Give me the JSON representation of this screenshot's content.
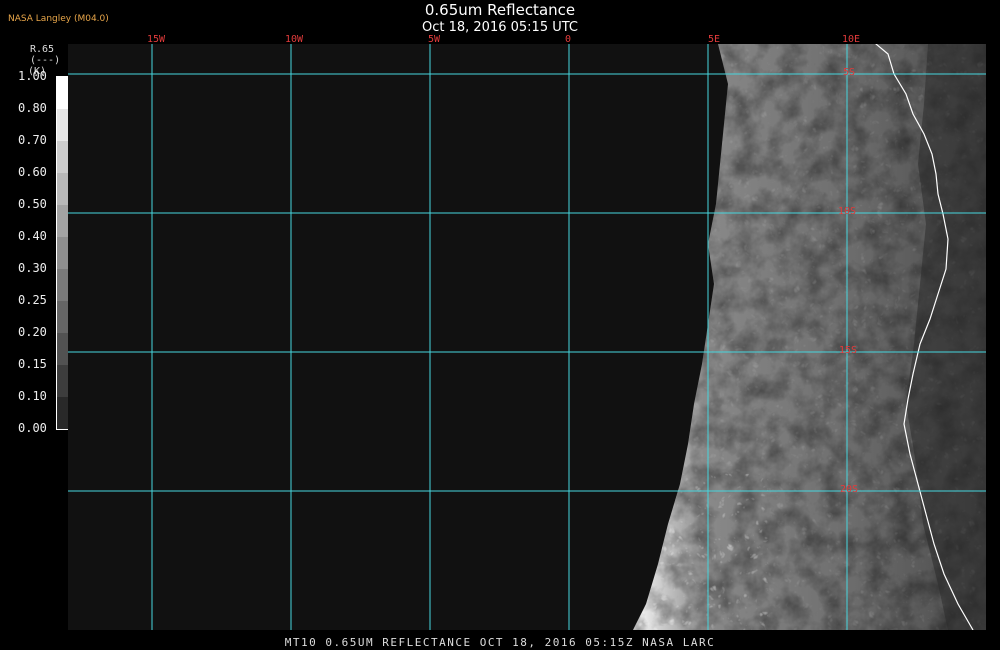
{
  "header": {
    "title": "0.65um Reflectance",
    "subtitle": "Oct 18, 2016 05:15 UTC",
    "producer": "NASA Langley (M04.0)"
  },
  "legend": {
    "title_lines": [
      "R.65",
      "(---)",
      "(K)"
    ],
    "ticks": [
      "1.00",
      "0.80",
      "0.70",
      "0.60",
      "0.50",
      "0.40",
      "0.30",
      "0.25",
      "0.20",
      "0.15",
      "0.10",
      "0.00"
    ]
  },
  "grid": {
    "longitude_labels": [
      "15W",
      "10W",
      "5W",
      "0",
      "5E",
      "10E"
    ],
    "latitude_labels": [
      "5S",
      "10S",
      "15S",
      "20S"
    ],
    "line_color": "#46d6de",
    "label_color": "#e23b3b"
  },
  "footer": "MT10  0.65UM REFLECTANCE   OCT 18, 2016 05:15Z   NASA LARC"
}
